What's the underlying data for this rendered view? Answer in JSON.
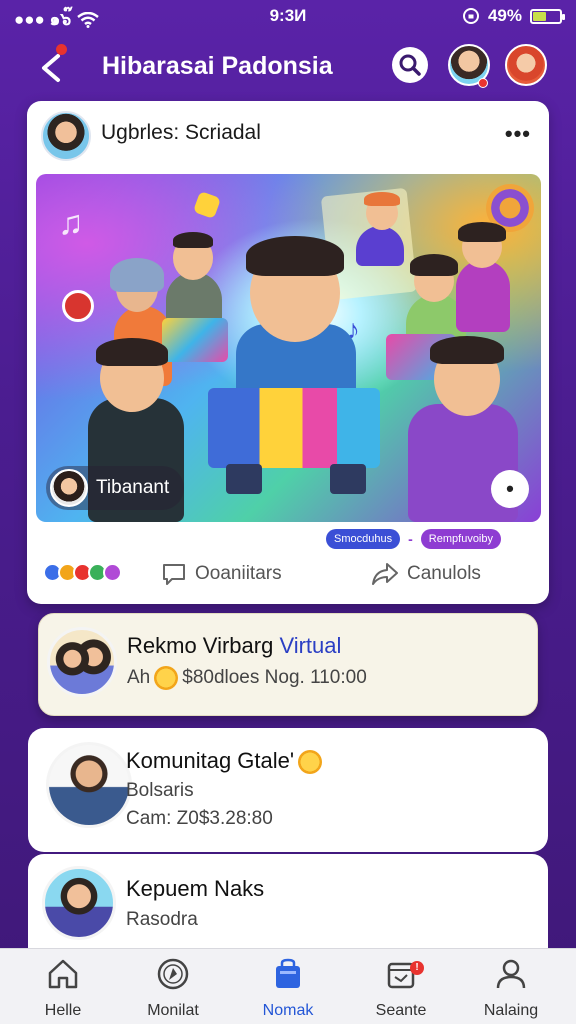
{
  "status_bar": {
    "carrier": "●●● ๑๖๊",
    "time": "9:3И",
    "battery_text": "49%",
    "battery_level": 0.49
  },
  "header": {
    "title": "Hibarasai Padonsia"
  },
  "post": {
    "author_name": "Ugbrles: Scriadal",
    "menu": "•••",
    "image_tag_label": "Tibanant",
    "image_more": "•",
    "pills": [
      "Smocduhus",
      "Rempfuvoiby"
    ],
    "pill_separator": "-",
    "comments_label": "Ooaniitars",
    "share_label": "Canulols",
    "reaction_colors": [
      "#3b6ee8",
      "#f2a51a",
      "#e8332f",
      "#3ab05a",
      "#b04ad6"
    ]
  },
  "list": [
    {
      "title": "Rekmo Virbarg ",
      "title_accent": "Virtual",
      "subtitle_prefix": "Ah",
      "subtitle": "$80dloes Nog. 110:00",
      "highlight": true
    },
    {
      "title": "Komunitag Gtale'",
      "line2": "Bolsaris",
      "line3": "Cam: Z0$3.28:80",
      "highlight": false
    },
    {
      "title": "Kepuem Naks",
      "line2": "Rasodra",
      "highlight": false
    }
  ],
  "bottom_nav": [
    {
      "label": "Helle",
      "icon": "home-icon"
    },
    {
      "label": "Monilat",
      "icon": "compass-icon"
    },
    {
      "label": "Nomak",
      "icon": "bag-icon",
      "active": true
    },
    {
      "label": "Seante",
      "icon": "calendar-icon",
      "badge": "!"
    },
    {
      "label": "Nalaing",
      "icon": "profile-icon"
    }
  ]
}
